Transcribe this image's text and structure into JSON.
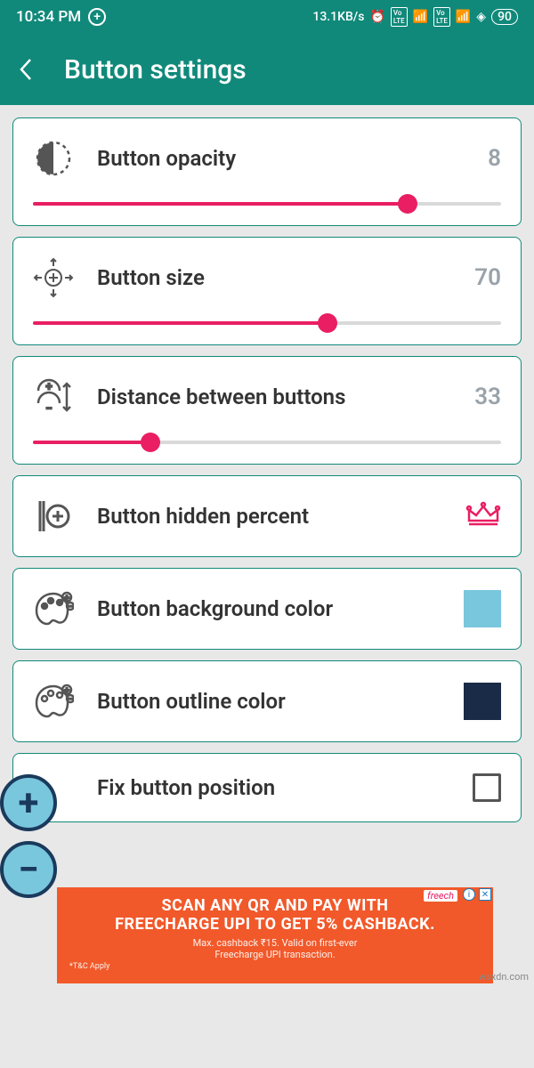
{
  "status": {
    "time": "10:34 PM",
    "speed": "13.1KB/s",
    "battery": "90"
  },
  "appbar": {
    "title": "Button settings"
  },
  "settings": {
    "opacity": {
      "label": "Button opacity",
      "value": "8",
      "percent": 80
    },
    "size": {
      "label": "Button size",
      "value": "70",
      "percent": 63
    },
    "distance": {
      "label": "Distance between buttons",
      "value": "33",
      "percent": 25
    },
    "hidden": {
      "label": "Button hidden percent"
    },
    "bgcolor": {
      "label": "Button background color",
      "swatch": "#79c7dd"
    },
    "outline": {
      "label": "Button outline color",
      "swatch": "#1a2b47"
    },
    "fixpos": {
      "label": "Fix button position"
    }
  },
  "ad": {
    "brand": "freech",
    "line1": "SCAN ANY QR AND PAY WITH",
    "line2": "FREECHARGE UPI TO GET 5% CASHBACK.",
    "sub1": "Max. cashback ₹15. Valid on first-ever",
    "sub2": "Freecharge UPI transaction.",
    "tc": "*T&C Apply"
  },
  "watermark": "wsxdn.com"
}
